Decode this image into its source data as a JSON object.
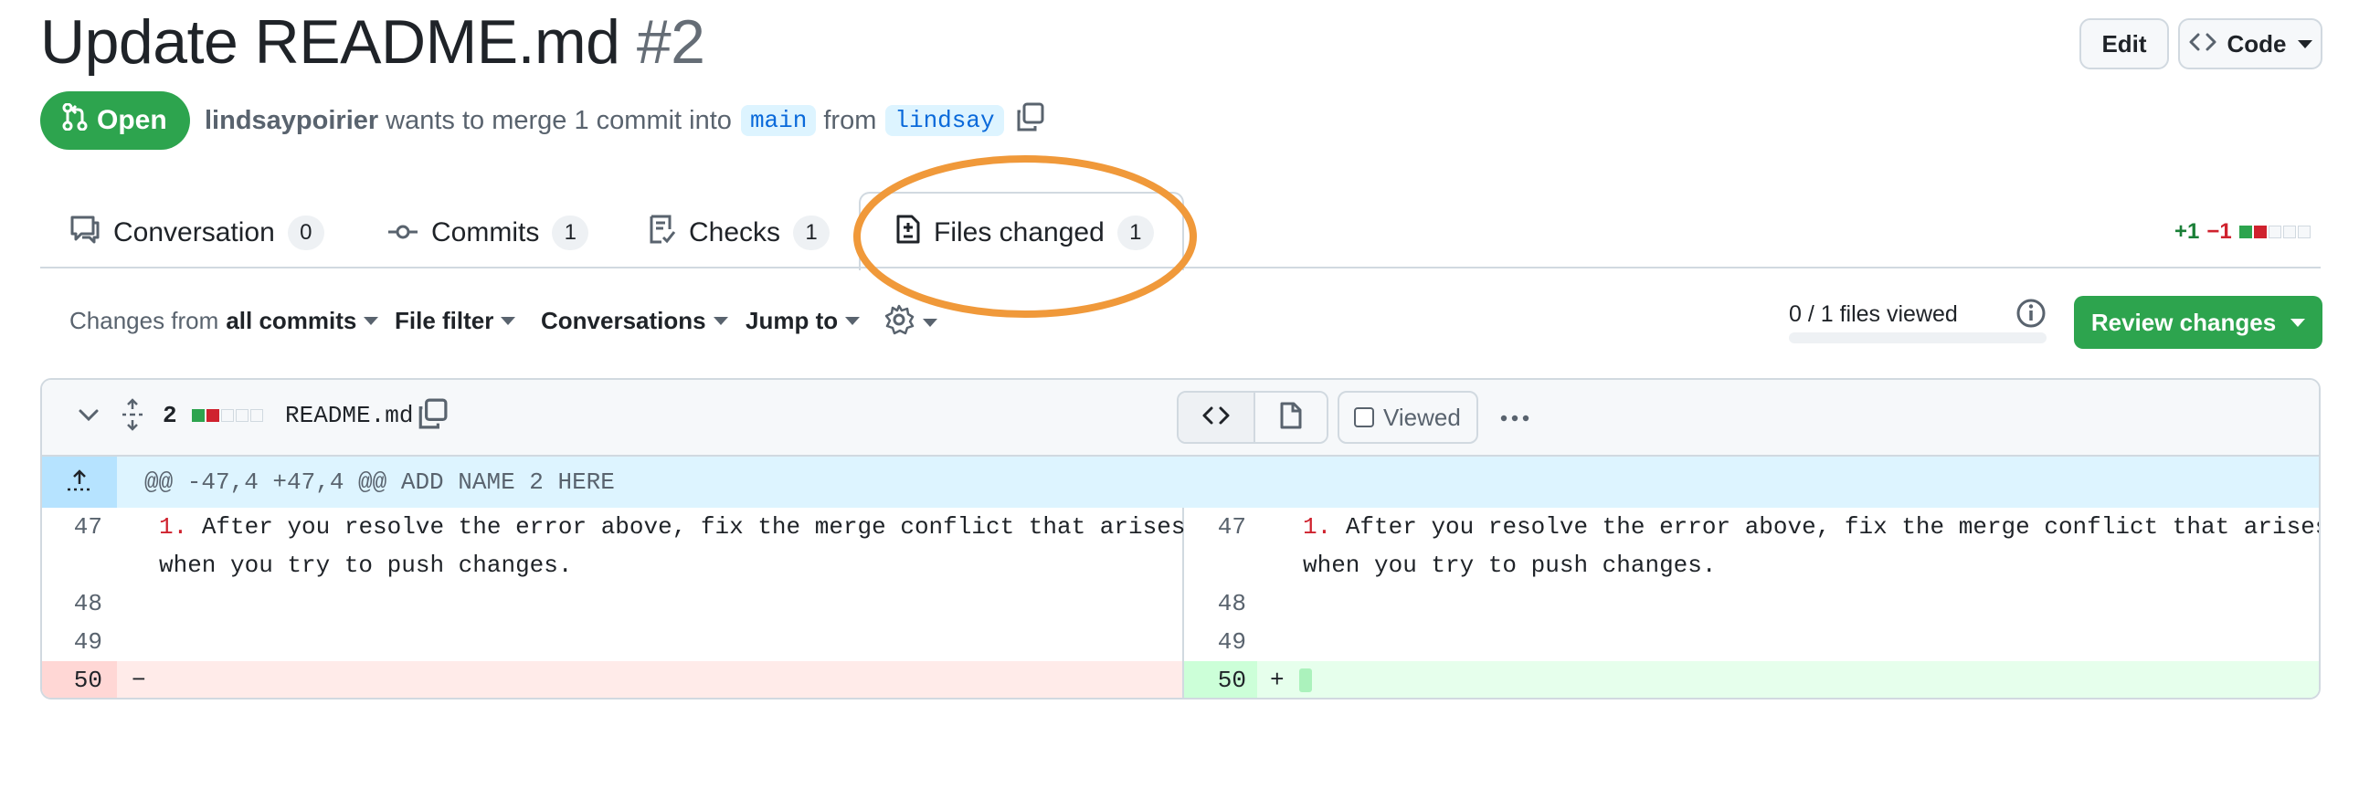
{
  "pr": {
    "title": "Update README.md",
    "number": "#2",
    "state": "Open",
    "author": "lindsaypoirier",
    "merge_text": "wants to merge 1 commit into",
    "base_branch": "main",
    "from_text": "from",
    "head_branch": "lindsay"
  },
  "header_buttons": {
    "edit": "Edit",
    "code": "Code"
  },
  "tabs": [
    {
      "label": "Conversation",
      "count": "0",
      "icon": "comment-icon"
    },
    {
      "label": "Commits",
      "count": "1",
      "icon": "commit-icon"
    },
    {
      "label": "Checks",
      "count": "1",
      "icon": "checklist-icon"
    },
    {
      "label": "Files changed",
      "count": "1",
      "icon": "file-diff-icon",
      "active": true
    }
  ],
  "diffstat": {
    "additions": "+1",
    "deletions": "−1"
  },
  "toolbar": {
    "changes_from_prefix": "Changes from",
    "changes_from_value": "all commits",
    "file_filter": "File filter",
    "conversations": "Conversations",
    "jump_to": "Jump to",
    "files_viewed": "0 / 1 files viewed",
    "review_changes": "Review changes"
  },
  "file": {
    "change_count": "2",
    "name": "README.md",
    "viewed_label": "Viewed",
    "hunk_header": "@@ -47,4 +47,4 @@ ADD NAME 2 HERE"
  },
  "diff": {
    "left": [
      {
        "line": "47",
        "marker": "1.",
        "text": "After you resolve the error above, fix the merge conflict that arises",
        "cont": "when you try to push changes."
      },
      {
        "line": "48",
        "text": ""
      },
      {
        "line": "49",
        "text": ""
      },
      {
        "line": "50",
        "sign": "−",
        "type": "deletion"
      }
    ],
    "right": [
      {
        "line": "47",
        "marker": "1.",
        "text": "After you resolve the error above, fix the merge conflict that arises",
        "cont": "when you try to push changes."
      },
      {
        "line": "48",
        "text": ""
      },
      {
        "line": "49",
        "text": ""
      },
      {
        "line": "50",
        "sign": "+",
        "type": "addition"
      }
    ]
  },
  "colors": {
    "accent_green": "#2da44e",
    "deletion_bg": "#ffebe9",
    "addition_bg": "#e6ffec",
    "hunk_bg": "#ddf4ff",
    "annotation_circle": "#f0993a"
  }
}
